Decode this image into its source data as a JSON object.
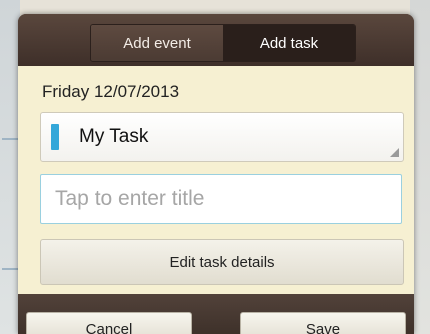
{
  "tabs": {
    "add_event": "Add event",
    "add_task": "Add task",
    "active": "add_task"
  },
  "form": {
    "date": "Friday 12/07/2013",
    "task_list": "My Task",
    "task_list_color": "#34a7d9",
    "title_value": "",
    "title_placeholder": "Tap to enter title",
    "edit_details_label": "Edit task details"
  },
  "actions": {
    "cancel_label": "Cancel",
    "save_label": "Save"
  }
}
